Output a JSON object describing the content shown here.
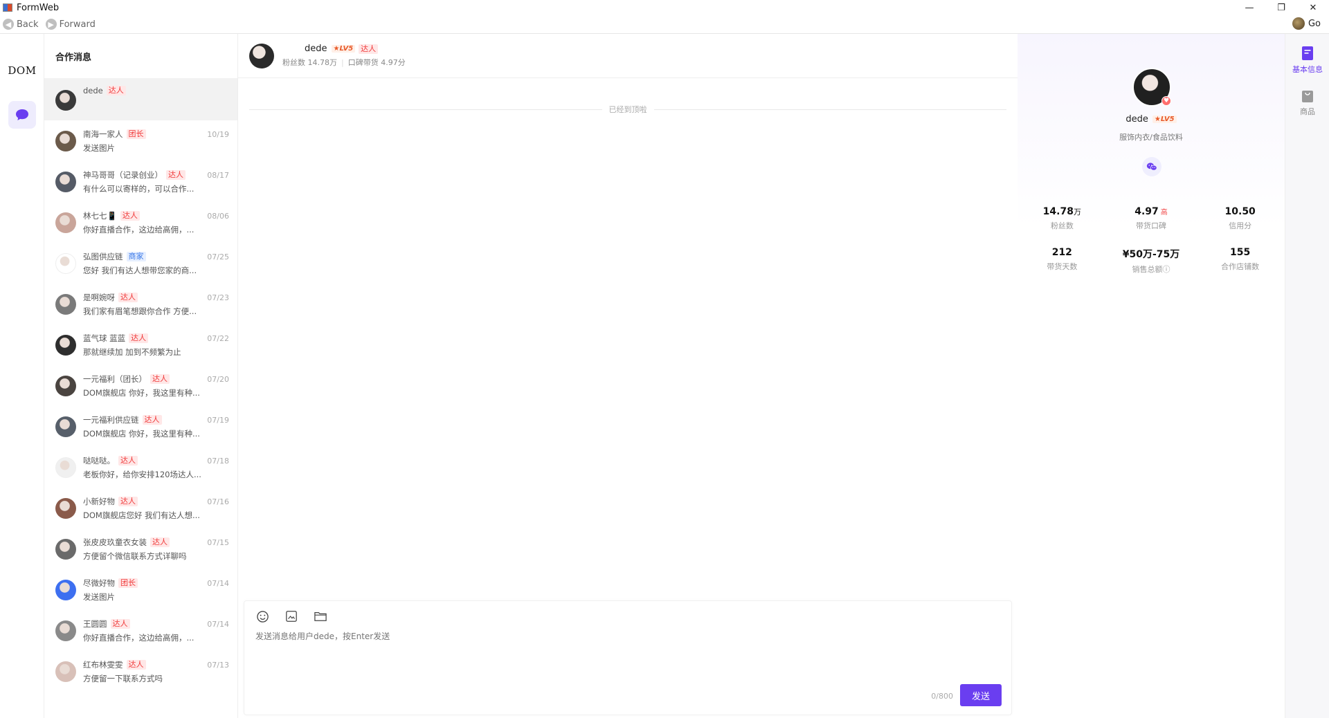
{
  "window": {
    "title": "FormWeb",
    "minimize": "—",
    "restore": "❐",
    "close": "✕"
  },
  "nav": {
    "back": "Back",
    "forward": "Forward",
    "go": "Go"
  },
  "rail": {
    "logo": "DOM"
  },
  "conversations": {
    "header": "合作消息",
    "items": [
      {
        "name": "dede",
        "tag": "达人",
        "tag_color": "red",
        "date": "",
        "msg": "",
        "avatar": "#3a3a3a"
      },
      {
        "name": "南海一家人",
        "tag": "团长",
        "tag_color": "red",
        "date": "10/19",
        "msg": "发送图片",
        "avatar": "#6b5a4a"
      },
      {
        "name": "神马哥哥（记录创业）",
        "tag": "达人",
        "tag_color": "red",
        "date": "08/17",
        "msg": "有什么可以寄样的，可以合作...",
        "avatar": "#555b66"
      },
      {
        "name": "林七七📱",
        "tag": "达人",
        "tag_color": "red",
        "date": "08/06",
        "msg": "你好直播合作，这边给高佣，...",
        "avatar": "#c9a59a"
      },
      {
        "name": "弘图供应链",
        "tag": "商家",
        "tag_color": "blue",
        "date": "07/25",
        "msg": "您好 我们有达人想带您家的商...",
        "avatar": "#ffffff"
      },
      {
        "name": "是啊婉呀",
        "tag": "达人",
        "tag_color": "red",
        "date": "07/23",
        "msg": "我们家有眉笔想跟你合作 方便...",
        "avatar": "#7a7a7a"
      },
      {
        "name": "蓝气球 蓝蓝",
        "tag": "达人",
        "tag_color": "red",
        "date": "07/22",
        "msg": "那就继续加 加到不频繁为止",
        "avatar": "#2e2e2e"
      },
      {
        "name": "一元福利（团长）",
        "tag": "达人",
        "tag_color": "red",
        "date": "07/20",
        "msg": "DOM旗舰店 你好，我这里有种...",
        "avatar": "#4a4440"
      },
      {
        "name": "一元福利供应链",
        "tag": "达人",
        "tag_color": "red",
        "date": "07/19",
        "msg": "DOM旗舰店 你好，我这里有种...",
        "avatar": "#575f6a"
      },
      {
        "name": "哒哒哒。",
        "tag": "达人",
        "tag_color": "red",
        "date": "07/18",
        "msg": "老板你好，给你安排120场达人...",
        "avatar": "#f0f0f0"
      },
      {
        "name": "小新好物",
        "tag": "达人",
        "tag_color": "red",
        "date": "07/16",
        "msg": "DOM旗舰店您好 我们有达人想...",
        "avatar": "#8a5a4a"
      },
      {
        "name": "张皮皮玖童衣女装",
        "tag": "达人",
        "tag_color": "red",
        "date": "07/15",
        "msg": "方便留个微信联系方式详聊吗",
        "avatar": "#6a6a6a"
      },
      {
        "name": "尽微好物",
        "tag": "团长",
        "tag_color": "red",
        "date": "07/14",
        "msg": "发送图片",
        "avatar": "#3d6ff0"
      },
      {
        "name": "王圆圆",
        "tag": "达人",
        "tag_color": "red",
        "date": "07/14",
        "msg": "你好直播合作，这边给高佣，...",
        "avatar": "#8a8a8a"
      },
      {
        "name": "红布林雯雯",
        "tag": "达人",
        "tag_color": "red",
        "date": "07/13",
        "msg": "方便留一下联系方式吗",
        "avatar": "#d8c0b8"
      }
    ]
  },
  "chat": {
    "name": "dede",
    "level": "★LV5",
    "tag": "达人",
    "fans": "粉丝数 14.78万",
    "rating": "口碑带货 4.97分",
    "top_reached": "已经到顶啦",
    "placeholder": "发送消息给用户dede，按Enter发送",
    "char_count": "0/800",
    "send": "发送"
  },
  "profile": {
    "name": "dede",
    "level": "★LV5",
    "category": "服饰内衣/食品饮料",
    "stats": [
      {
        "value": "14.78",
        "unit": "万",
        "hi": "",
        "label": "粉丝数"
      },
      {
        "value": "4.97",
        "unit": "",
        "hi": "高",
        "label": "带货口碑"
      },
      {
        "value": "10.50",
        "unit": "",
        "hi": "",
        "label": "信用分"
      },
      {
        "value": "212",
        "unit": "",
        "hi": "",
        "label": "带货天数"
      },
      {
        "value": "¥50万-75万",
        "unit": "",
        "hi": "",
        "label": "销售总额ⓘ"
      },
      {
        "value": "155",
        "unit": "",
        "hi": "",
        "label": "合作店铺数"
      }
    ]
  },
  "right_rail": {
    "tabs": [
      {
        "label": "基本信息",
        "color": "#6a3ef0"
      },
      {
        "label": "商品",
        "color": "#888888"
      }
    ]
  }
}
